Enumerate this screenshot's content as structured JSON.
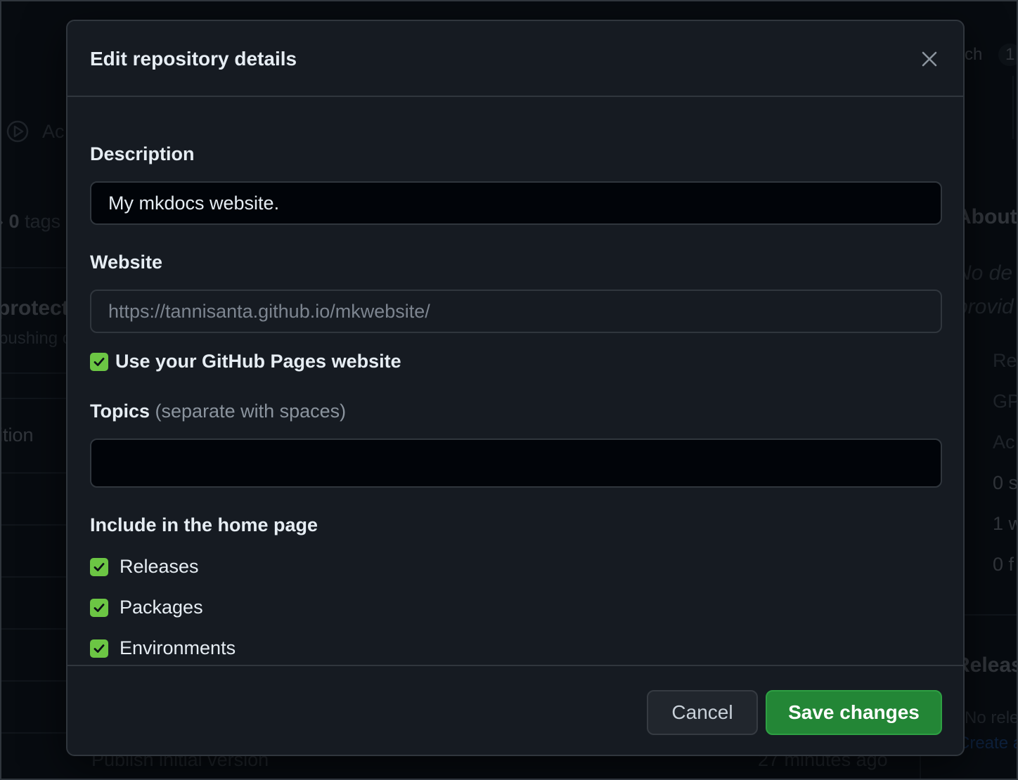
{
  "background": {
    "left_column": {
      "actions_label": "Ac",
      "tags_count": "0",
      "tags_label": "tags",
      "protect_text": "protect",
      "pushing_text": "pushing o",
      "addition_text": "ition"
    },
    "right_column": {
      "branch_text": "ch",
      "branch_count": "1",
      "about_heading": "About",
      "desc_line1": "No de",
      "desc_line2": "provid",
      "items": [
        "Re",
        "GP",
        "Ac",
        "0 s",
        "1 w",
        "0 f"
      ],
      "releases_heading": "Releas",
      "no_releases": "No relea",
      "create_link": "Create a"
    },
    "commit": {
      "message": "Publish initial version",
      "time": "27 minutes ago"
    }
  },
  "modal": {
    "title": "Edit repository details",
    "close_icon": "x-icon",
    "description": {
      "label": "Description",
      "value": "My mkdocs website."
    },
    "website": {
      "label": "Website",
      "value": "https://tannisanta.github.io/mkwebsite/"
    },
    "use_pages": {
      "label": "Use your GitHub Pages website",
      "checked": true
    },
    "topics": {
      "label": "Topics",
      "hint": "(separate with spaces)",
      "value": ""
    },
    "home_page": {
      "heading": "Include in the home page",
      "options": [
        {
          "label": "Releases",
          "checked": true
        },
        {
          "label": "Packages",
          "checked": true
        },
        {
          "label": "Environments",
          "checked": true
        }
      ]
    },
    "buttons": {
      "cancel": "Cancel",
      "save": "Save changes"
    }
  },
  "colors": {
    "save_button": "#238636",
    "checkbox": "#6cc644",
    "modal_bg": "#161b22",
    "border": "#30363d"
  }
}
